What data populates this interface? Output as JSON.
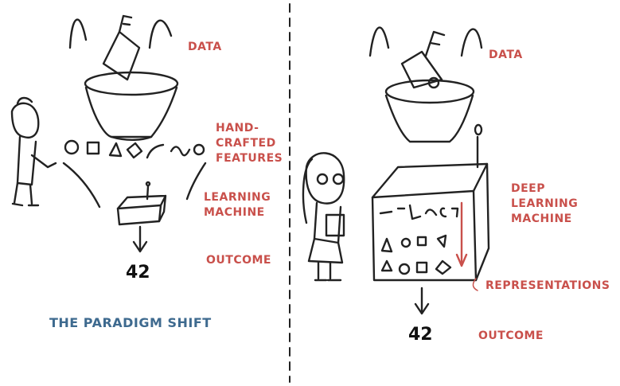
{
  "left": {
    "data_label": "DATA",
    "features_label": "HAND-\nCRAFTED\nFEATURES",
    "machine_label": "LEARNING\nMACHINE",
    "outcome_label": "OUTCOME",
    "outcome_value": "42",
    "title": "THE PARADIGM SHIFT"
  },
  "right": {
    "data_label": "DATA",
    "machine_label": "DEEP\nLEARNING\nMACHINE",
    "representations_label": "REPRESENTATIONS",
    "outcome_label": "OUTCOME",
    "outcome_value": "42"
  },
  "colors": {
    "label": "#c9504b",
    "title": "#3e6a8f",
    "ink": "#222222"
  }
}
